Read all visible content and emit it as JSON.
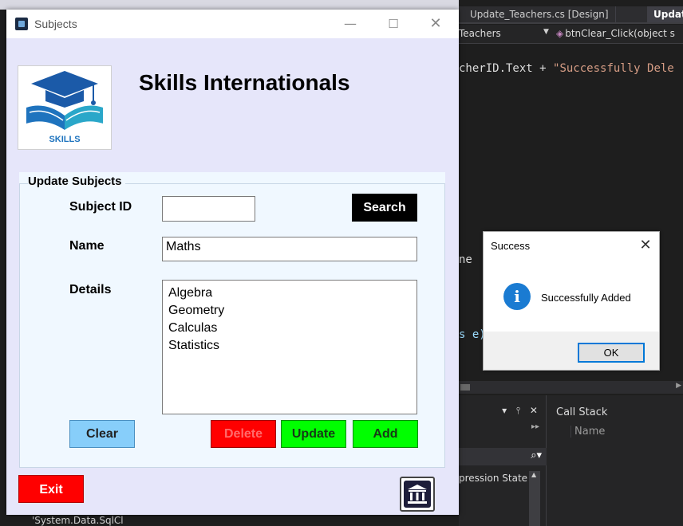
{
  "ide": {
    "tabs": [
      {
        "label": "Update_Teachers.cs [Design]"
      },
      {
        "label": "Updat"
      }
    ],
    "nav": {
      "class_fragment": "Teachers",
      "method_fragment": "btnClear_Click(object s"
    },
    "code": {
      "line1_ident": "cherID.Text + ",
      "line1_string": "\"Successfully Dele",
      "frag_ne": "ne ",
      "frag_se": "s e)"
    },
    "panel": {
      "controls": "▾ ⫯ ✕",
      "dots": "▸▸",
      "search_icon": "⌕▾",
      "expression_state": "pression State",
      "callstack_title": "Call Stack",
      "callstack_col_name": "Name"
    },
    "behind_text": "'System.Data.SqlCl"
  },
  "window": {
    "title": "Subjects",
    "controls": {
      "minimize": "—",
      "maximize": "☐",
      "close": "✕"
    },
    "logo_text": "SKILLS",
    "company_name": "Skills Internationals",
    "group_title": "Update Subjects",
    "labels": {
      "subject_id": "Subject ID",
      "name": "Name",
      "details": "Details"
    },
    "fields": {
      "subject_id": "",
      "name": "Maths",
      "details": [
        "Algebra",
        "Geometry",
        "Calculas",
        "Statistics"
      ]
    },
    "buttons": {
      "search": "Search",
      "clear": "Clear",
      "delete": "Delete",
      "update": "Update",
      "add": "Add",
      "exit": "Exit"
    },
    "home_icon": "bank-building-icon"
  },
  "dialog": {
    "title": "Success",
    "close": "✕",
    "icon": "i",
    "message": "Successfully Added",
    "ok": "OK"
  }
}
